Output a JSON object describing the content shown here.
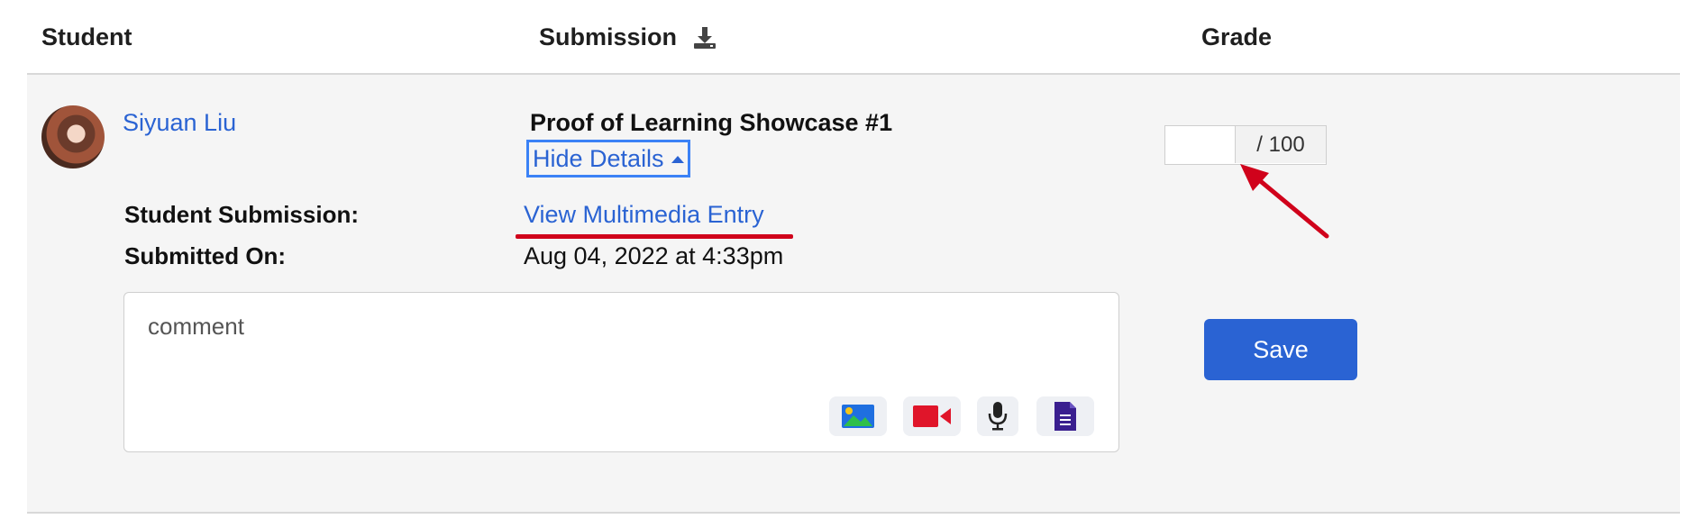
{
  "header": {
    "student_label": "Student",
    "submission_label": "Submission",
    "grade_label": "Grade"
  },
  "row": {
    "student_name": "Siyuan Liu",
    "assignment_title": "Proof of Learning Showcase #1",
    "hide_details_label": "Hide Details",
    "student_submission_label": "Student Submission:",
    "view_entry_label": "View Multimedia Entry",
    "submitted_on_label": "Submitted On:",
    "submitted_on_value": "Aug 04, 2022 at 4:33pm",
    "comment_placeholder": "comment",
    "grade_value": "",
    "grade_max": "/ 100",
    "save_label": "Save"
  },
  "icons": {
    "download": "download-icon",
    "image": "image-icon",
    "video": "video-camera-icon",
    "microphone": "microphone-icon",
    "document": "document-icon"
  },
  "colors": {
    "link": "#2a63d3",
    "focus_outline": "#3b82f6",
    "annotation_red": "#d0021b",
    "save_button": "#2a63d3",
    "row_background": "#f5f5f5"
  }
}
